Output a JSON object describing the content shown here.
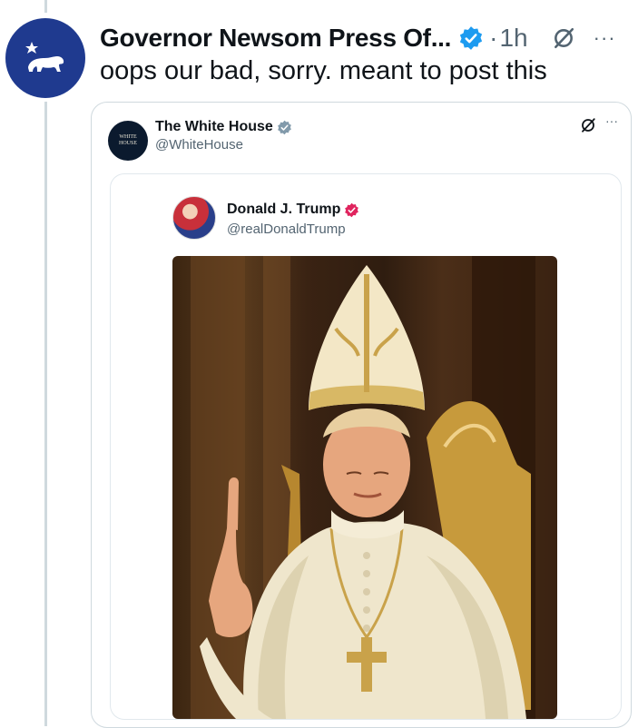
{
  "post": {
    "author": "Governor Newsom Press Of...",
    "dot": "·",
    "time": "1h",
    "more": "···",
    "text": "oops our bad, sorry. meant to post this",
    "verified_color": "#1d9bf0",
    "avatar_icon": "california-bear-icon"
  },
  "quote": {
    "name": "The White House",
    "handle": "@WhiteHouse",
    "more": "···",
    "avatar_text_line1": "WHITE",
    "avatar_text_line2": "HOUSE",
    "badge_color": "#829aab"
  },
  "inner_quote": {
    "name": "Donald J. Trump",
    "handle": "@realDonaldTrump",
    "badge_color": "#e0245e"
  }
}
